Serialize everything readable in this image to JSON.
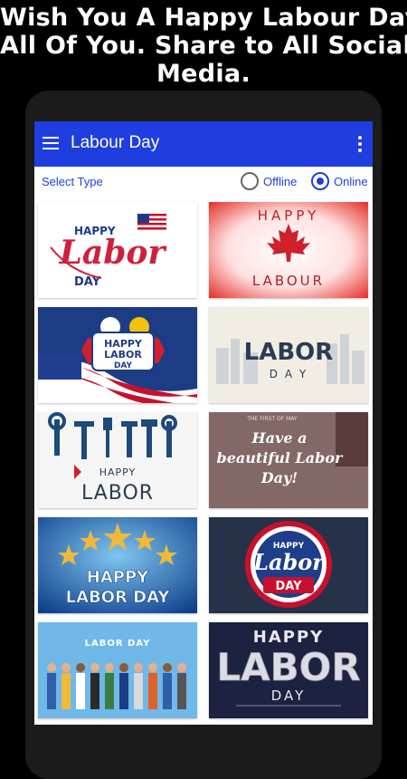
{
  "promo": {
    "line1": "Wish You A Happy Labour Day",
    "line2": "All Of You. Share to All Social",
    "line3": "Media."
  },
  "appbar": {
    "title": "Labour Day",
    "menu_icon": "hamburger-menu-icon",
    "more_icon": "more-vert-icon",
    "color": "#1f3ee0"
  },
  "select": {
    "label": "Select Type",
    "options": [
      {
        "label": "Offline",
        "selected": false
      },
      {
        "label": "Online",
        "selected": true
      }
    ]
  },
  "cards": [
    {
      "t1": "HAPPY",
      "t2": "Labor",
      "t3": "DAY"
    },
    {
      "t1": "HAPPY",
      "t2": "LABOUR"
    },
    {
      "t1": "HAPPY",
      "t2": "LABOR",
      "t3": "DAY"
    },
    {
      "t1": "LABOR",
      "t2": "D A Y"
    },
    {
      "t1": "HAPPY",
      "t2": "LABOR"
    },
    {
      "t1": "THE FIRST OF MAY",
      "t2": "Have a",
      "t3": "beautiful Labor",
      "t4": "Day!"
    },
    {
      "t1": "HAPPY",
      "t2": "LABOR DAY"
    },
    {
      "t1": "HAPPY",
      "t2": "Labor",
      "t3": "DAY"
    },
    {
      "t1": "LABOR DAY"
    },
    {
      "t1": "HAPPY",
      "t2": "LABOR",
      "t3": "DAY"
    }
  ]
}
